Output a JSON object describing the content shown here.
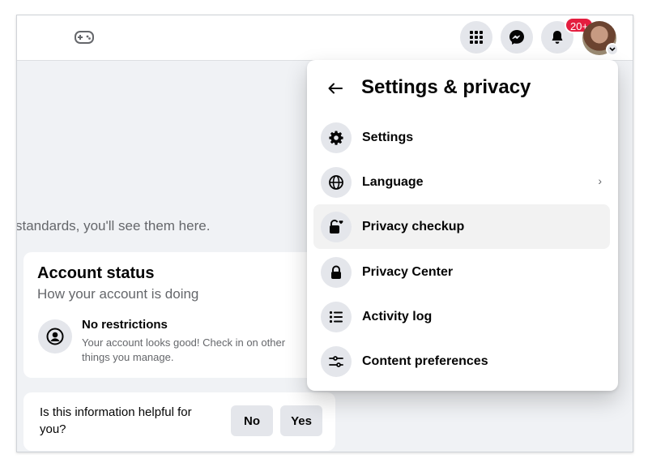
{
  "topbar": {
    "notifications_badge": "20+",
    "icons": [
      "game-controller-icon",
      "menu-grid-icon",
      "messenger-icon",
      "bell-icon",
      "avatar",
      "chevron-down-icon"
    ]
  },
  "main": {
    "partial_text": "standards, you'll see them here."
  },
  "account_status": {
    "title": "Account status",
    "subtitle": "How your account is doing",
    "status_title": "No restrictions",
    "status_desc": "Your account looks good! Check in on other things you manage."
  },
  "helpful": {
    "question": "Is this information helpful for you?",
    "no_label": "No",
    "yes_label": "Yes"
  },
  "dropdown": {
    "title": "Settings & privacy",
    "items": [
      {
        "label": "Settings",
        "icon": "gear-icon"
      },
      {
        "label": "Language",
        "icon": "globe-icon",
        "chevron": "›"
      },
      {
        "label": "Privacy checkup",
        "icon": "lock-heart-icon"
      },
      {
        "label": "Privacy Center",
        "icon": "lock-icon"
      },
      {
        "label": "Activity log",
        "icon": "list-icon"
      },
      {
        "label": "Content preferences",
        "icon": "sliders-icon"
      }
    ]
  },
  "colors": {
    "background": "#f0f2f5",
    "badge": "#e41e3f",
    "icon_bg": "#e4e6eb",
    "text_secondary": "#65676b"
  }
}
